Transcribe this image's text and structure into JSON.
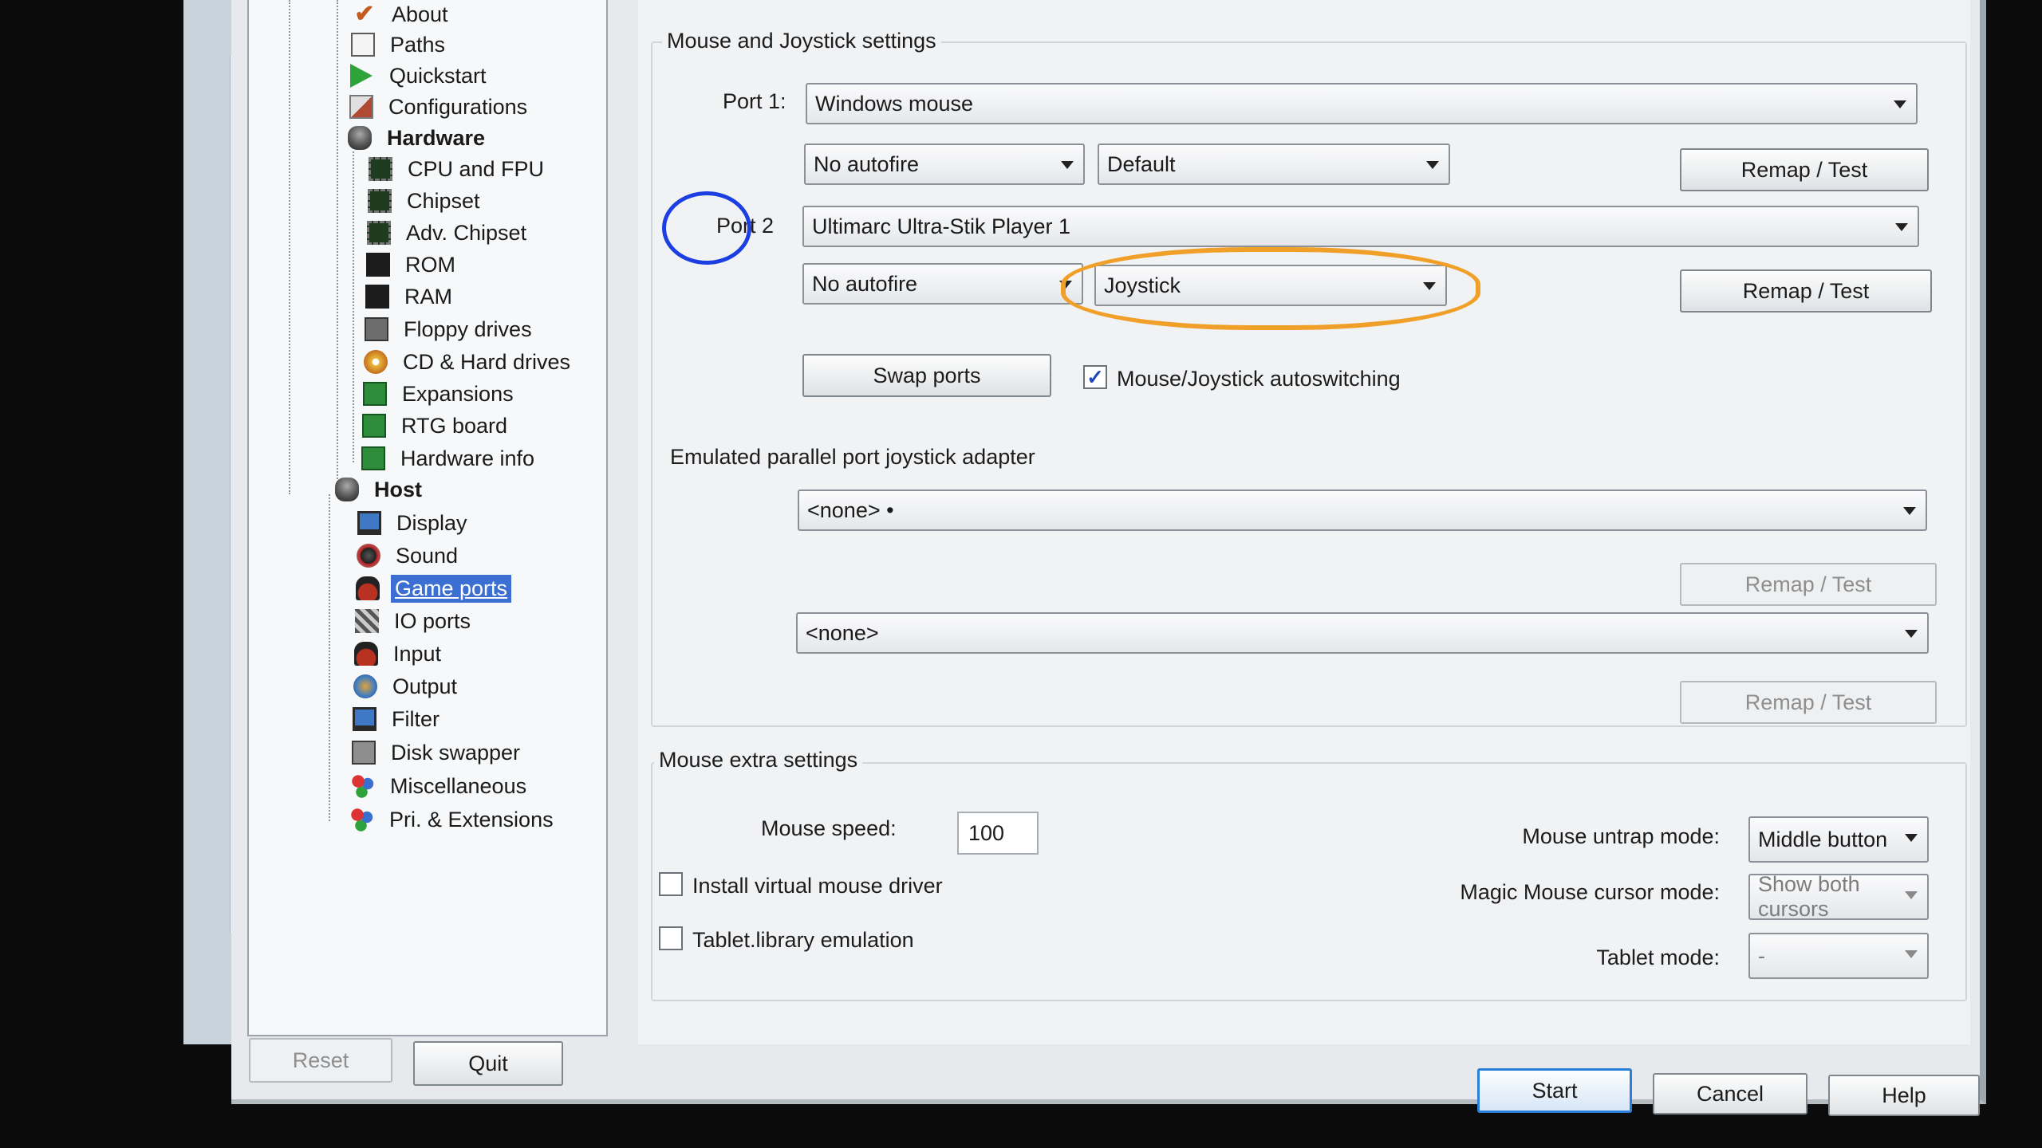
{
  "tree": {
    "items": [
      {
        "label": "About",
        "icon": "check-icon"
      },
      {
        "label": "Paths",
        "icon": "document-icon"
      },
      {
        "label": "Quickstart",
        "icon": "play-icon"
      },
      {
        "label": "Configurations",
        "icon": "config-icon"
      },
      {
        "label": "Hardware",
        "icon": "drum-icon"
      },
      {
        "label": "CPU and FPU",
        "icon": "chip-icon"
      },
      {
        "label": "Chipset",
        "icon": "chip-icon"
      },
      {
        "label": "Adv. Chipset",
        "icon": "chip-icon"
      },
      {
        "label": "ROM",
        "icon": "memory-icon"
      },
      {
        "label": "RAM",
        "icon": "memory-icon"
      },
      {
        "label": "Floppy drives",
        "icon": "floppy-icon"
      },
      {
        "label": "CD & Hard drives",
        "icon": "cd-icon"
      },
      {
        "label": "Expansions",
        "icon": "board-icon"
      },
      {
        "label": "RTG board",
        "icon": "board-icon"
      },
      {
        "label": "Hardware info",
        "icon": "board-icon"
      },
      {
        "label": "Host",
        "icon": "drum-icon"
      },
      {
        "label": "Display",
        "icon": "monitor-icon"
      },
      {
        "label": "Sound",
        "icon": "speaker-icon"
      },
      {
        "label": "Game ports",
        "icon": "joystick-icon"
      },
      {
        "label": "IO ports",
        "icon": "io-icon"
      },
      {
        "label": "Input",
        "icon": "joystick-icon"
      },
      {
        "label": "Output",
        "icon": "output-icon"
      },
      {
        "label": "Filter",
        "icon": "monitor-icon"
      },
      {
        "label": "Disk swapper",
        "icon": "swapper-icon"
      },
      {
        "label": "Miscellaneous",
        "icon": "misc-icon"
      },
      {
        "label": "Pri. & Extensions",
        "icon": "misc-icon"
      }
    ],
    "selected": "Game ports"
  },
  "mouse_joystick": {
    "title": "Mouse and Joystick settings",
    "port1_label": "Port 1:",
    "port1_device": "Windows mouse",
    "port1_autofire": "No autofire",
    "port1_mode": "Default",
    "port2_label": "Port 2",
    "port2_device": "Ultimarc Ultra-Stik Player 1",
    "port2_autofire": "No autofire",
    "port2_mode": "Joystick",
    "remap_label": "Remap / Test",
    "swap_label": "Swap ports",
    "autoswitch_label": "Mouse/Joystick autoswitching",
    "autoswitch_checked": true
  },
  "parallel": {
    "title": "Emulated parallel port joystick adapter",
    "port3_device": "<none> •",
    "port4_device": "<none>",
    "remap_label": "Remap / Test"
  },
  "mouse_extra": {
    "title": "Mouse extra settings",
    "speed_label": "Mouse speed:",
    "speed_value": "100",
    "virtual_driver_label": "Install virtual mouse driver",
    "virtual_driver_checked": false,
    "tablet_label": "Tablet.library emulation",
    "tablet_checked": false,
    "untrap_label": "Mouse untrap mode:",
    "untrap_value": "Middle button",
    "magic_label": "Magic Mouse cursor mode:",
    "magic_value": "Show both cursors",
    "tablet_mode_label": "Tablet mode:",
    "tablet_mode_value": "-"
  },
  "footer": {
    "reset": "Reset",
    "quit": "Quit",
    "start": "Start",
    "cancel": "Cancel",
    "help": "Help"
  },
  "annotations": {
    "blue": "#1b3fe0",
    "orange": "#f0a028"
  }
}
